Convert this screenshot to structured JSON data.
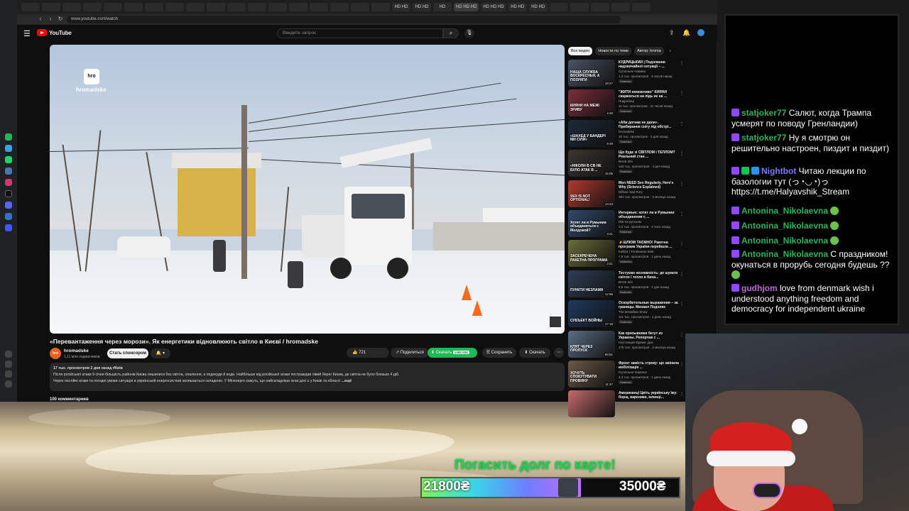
{
  "browser": {
    "url": "www.youtube.com/watch",
    "tabs": [
      "HD HD",
      "HD HD",
      "HD",
      "HD HD HD",
      "HD HD HD",
      "HD HD",
      "HD HD"
    ]
  },
  "youtube": {
    "logo": "YouTube",
    "search_placeholder": "Введите запрос",
    "video": {
      "watermark_short": "hro",
      "watermark": "hromadske",
      "title": "«Перевантаження через морози». Як енергетики відновлюють світло в Києві / hromadske",
      "channel": "hromadske",
      "subscribers": "1,11 млн подписчиков",
      "subscribe_label": "Стать спонсором",
      "likes": "721",
      "share": "Поделиться",
      "download": "Скачать",
      "download_size": "1488 ММ",
      "save": "Сохранить",
      "clip": "Скачать",
      "desc_meta": "17 тыс. просмотров  2 дня назад  #Київ",
      "desc_line1": "Після російської атаки 9 січня більшість районів Києва лишилися без світла, опалення, а подекуди й води. Найбільше від російської атаки постраждав лівий берег Києва, де світла не було близько 4 діб.",
      "desc_line2": "Через постійні атаки та погодні умови ситуація в українській енергосистемі залишається складною. У Міненерго кажуть, що найскладніша зона досі є у Києві та області",
      "desc_more": "...ещё",
      "comments": "100 комментариев"
    },
    "chips": [
      "Все видео",
      "Новости по теме",
      "Автор: hroma"
    ],
    "recommendations": [
      {
        "title": "КУДРИЦЬКИЙ | Подолання надзвичайної ситуації – ...",
        "channel": "Суспільне Новини",
        "meta": "1,3 тыс. просмотров · 5 часов назад",
        "badge": "Новинка",
        "duration": "18:27",
        "cap": "НАЩА СЛУЖБА ВОСКРЕСНЬЯ, А ПОЗУНГИ",
        "color": "#4a5463"
      },
      {
        "title": "\"ЖИТИ неможливо\" КИЯНИ скаржаться на лідь не на ...",
        "channel": "Подробиці",
        "meta": "11 тыс. просмотров · 11 часов назад",
        "badge": "Новинка",
        "duration": "4:48",
        "cap": "КИЯНИ НА МЕЖІ ЗРИВУ",
        "color": "#7a2f3a"
      },
      {
        "title": "«Аби догнав не дали». Прибирання снігу під обстрі...",
        "channel": "hromadske",
        "meta": "10 тыс. просмотров · 2 дня назад",
        "badge": "Новинка",
        "duration": "9:49",
        "cap": "«ШАХЕД У БАНДЕРІ МИ СІЛИ»",
        "color": "#1d2a3a"
      },
      {
        "title": "Що буде зі СВІТЛОМ і ТЕПЛОМ? Реальний стан ...",
        "channel": "ВН45 Info",
        "meta": "163 тыс. просмотров · 4 дня назад",
        "badge": "Новинка",
        "duration": "15:05",
        "cap": "«НІКОЛИ В СВ НЕ БУЛО АТАК В ...",
        "color": "#3b3531"
      },
      {
        "title": "Men NEED Sex Regularly, Here's Why (Science Explained)",
        "channel": "Diffuse Sad Rory",
        "meta": "391 тыс. просмотров · 3 месяца назад",
        "badge": "",
        "duration": "13:23",
        "cap": "SEX IS NOT OPTIONAL!",
        "color": "#b23a2e"
      },
      {
        "title": "Интервью: хотят ли в Румынии объединения с ...",
        "channel": "DW на русском",
        "meta": "3,3 тыс. просмотров · 4 часа назад",
        "badge": "Новинка",
        "duration": "3:21",
        "cap": "Хотят ли в Румынии объединяться с Молдовой?",
        "color": "#324a6b"
      },
      {
        "title": "⚡ШЛЮМ ТАЄМНО! Ракетна програма України перейшла ...",
        "channel": "Kalli24 | Телеканал Київ",
        "meta": "7,8 тыс. просмотров · 1 день назад",
        "badge": "Новинка",
        "duration": "3:21",
        "cap": "ЗАСЕКРЕЧЕНА РАКЕТНА ПРОГРАМА",
        "color": "#6b6e3a"
      },
      {
        "title": "Тестуємо незламність: де шукати світло і тепло в Києв...",
        "channel": "ВН45 Info",
        "meta": "5,6 тыс. просмотров · 2 дня назад",
        "badge": "Новинка",
        "duration": "12:56",
        "cap": "ПУНКТИ НЕЗЛАМН",
        "color": "#2e3e55"
      },
      {
        "title": "Оскорбительные выражения – за границы. Михаил Подоляк",
        "channel": "The Breakfast Show",
        "meta": "111 тыс. просмотров · 1 день назад",
        "badge": "Новинка",
        "duration": "17:19",
        "cap": "СУБЪЕКТ ВОЙНЫ",
        "color": "#1f3b5e"
      },
      {
        "title": "Как призывники бегут из Украины. Репортаж с ...",
        "channel": "Настоящее Время. Док",
        "meta": "176 тыс. просмотров · 2 месяца назад",
        "badge": "",
        "duration": "58:51",
        "cap": "КЛЯТ ЧЕРЕЗ ПРОПУСК",
        "color": "#5a6f86"
      },
      {
        "title": "Фронт замість строку: що змінила мобілізація ...",
        "channel": "Суспільне Черкаси",
        "meta": "4,3 тыс. просмотров · 1 день назад",
        "badge": "Новинка",
        "duration": "11:37",
        "cap": "ХОЧУТЬ СПОКУТУВАТИ ПРОВИНУ",
        "color": "#6a5a48"
      },
      {
        "title": "Американці Цвіть українську їжу: борщ, вареники, млинці...",
        "channel": "",
        "meta": "",
        "badge": "",
        "duration": "",
        "cap": "",
        "color": "#c76b6b"
      }
    ]
  },
  "chat": {
    "messages": [
      {
        "user": "statjoker77",
        "text": "Салют, когда Трампа усмерят по поводу Гренландии)",
        "color": "green",
        "badges": 1
      },
      {
        "user": "statjoker77",
        "text": "Ну я смотрю он решительно настроен, пиздит и пиздит)",
        "color": "green",
        "badges": 1
      },
      {
        "user": "Nightbot",
        "text": "Читаю лекции по базологии тут (っ◔◡◔)っ https://t.me/Halyavshik_Stream",
        "color": "blue",
        "badges": 3
      },
      {
        "user": "Antonina_Nikolaevna",
        "text": "",
        "color": "green",
        "badges": 1,
        "emote": true
      },
      {
        "user": "Antonina_Nikolaevna",
        "text": "",
        "color": "green",
        "badges": 1,
        "emote": true
      },
      {
        "user": "Antonina_Nikolaevna",
        "text": "",
        "color": "green",
        "badges": 1,
        "emote": true
      },
      {
        "user": "Antonina_Nikolaevna",
        "text": "С праздником! окунаться в прорубь сегодня будешь ??",
        "color": "green",
        "badges": 1,
        "emote": true
      },
      {
        "user": "gudhjom",
        "text": "love from denmark wish i understood anything freedom and democracy for independent ukraine",
        "color": "purple",
        "badges": 1
      }
    ]
  },
  "donation": {
    "title": "Погасить долг по карте!",
    "current": "21800₴",
    "goal": "35000₴",
    "progress": 0.62
  }
}
